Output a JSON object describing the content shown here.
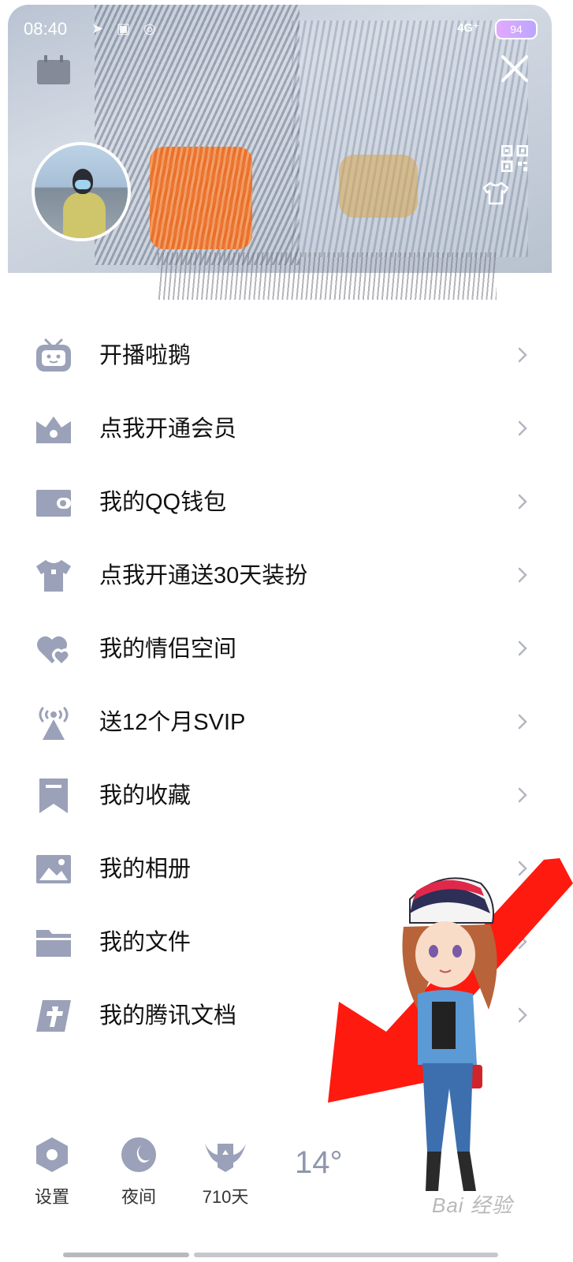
{
  "status_bar": {
    "time": "08:40",
    "network": "4G⁺",
    "battery": "94"
  },
  "menu": {
    "items": [
      {
        "label": "开播啦鹅",
        "icon": "tv-robot-icon"
      },
      {
        "label": "点我开通会员",
        "icon": "crown-icon"
      },
      {
        "label": "我的QQ钱包",
        "icon": "wallet-icon"
      },
      {
        "label": "点我开通送30天装扮",
        "icon": "tshirt-icon"
      },
      {
        "label": "我的情侣空间",
        "icon": "hearts-icon"
      },
      {
        "label": "送12个月SVIP",
        "icon": "broadcast-icon"
      },
      {
        "label": "我的收藏",
        "icon": "bookmark-icon"
      },
      {
        "label": "我的相册",
        "icon": "photo-icon"
      },
      {
        "label": "我的文件",
        "icon": "folder-icon"
      },
      {
        "label": "我的腾讯文档",
        "icon": "docs-icon"
      }
    ]
  },
  "bottom_bar": {
    "settings_label": "设置",
    "night_label": "夜间",
    "days_label": "710天",
    "temperature": "14°"
  },
  "colors": {
    "icon": "#9aa1b8",
    "chevron": "#b3b6c0",
    "arrow": "#ff1a10"
  }
}
